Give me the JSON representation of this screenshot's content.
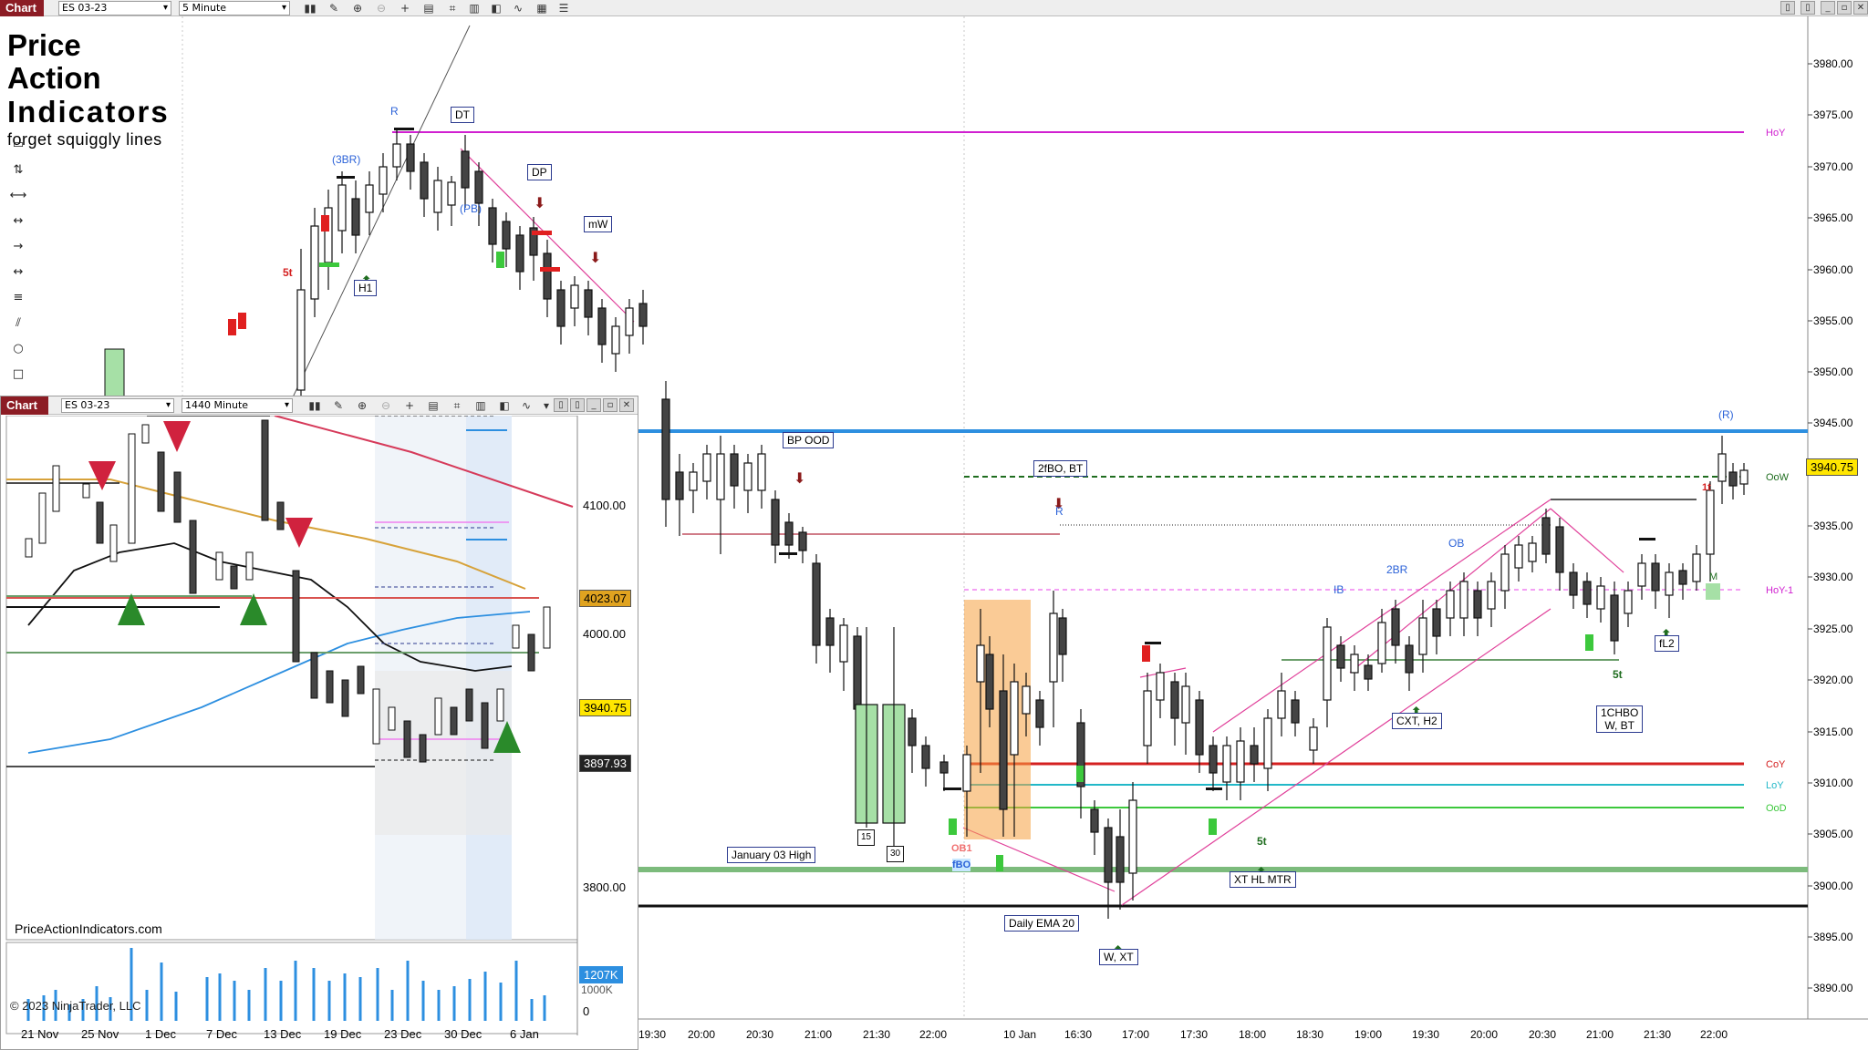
{
  "toolbar": {
    "tab_label": "Chart",
    "instrument": "ES 03-23",
    "interval": "5 Minute",
    "window_controls": [
      "minimize",
      "restore",
      "close"
    ]
  },
  "logo": {
    "line1": "Price Action",
    "line2": "Indicators",
    "line3": "forget squiggly lines"
  },
  "main_axis": {
    "price_ticks": [
      "3980.00",
      "3975.00",
      "3970.00",
      "3965.00",
      "3960.00",
      "3955.00",
      "3950.00",
      "3945.00",
      "3940.00",
      "3935.00",
      "3930.00",
      "3925.00",
      "3920.00",
      "3915.00",
      "3910.00",
      "3905.00",
      "3900.00",
      "3895.00",
      "3890.00"
    ],
    "time_ticks": [
      "19:30",
      "20:00",
      "20:30",
      "21:00",
      "21:30",
      "22:00",
      "10 Jan",
      "16:30",
      "17:00",
      "17:30",
      "18:00",
      "18:30",
      "19:00",
      "19:30",
      "20:00",
      "20:30",
      "21:00",
      "21:30",
      "22:00"
    ],
    "last_price": "3940.75"
  },
  "levels": {
    "hoy": "HoY",
    "oow": "OoW",
    "hoy1": "HoY-1",
    "coy": "CoY",
    "loy": "LoY",
    "ood": "OoD"
  },
  "annotations": {
    "r_top": "R",
    "dt": "DT",
    "three_br": "(3BR)",
    "dp": "DP",
    "pb": "(PB)",
    "mw": "mW",
    "h1": "H1",
    "five_t_left": "5t",
    "bp_ood": "BP OOD",
    "two_fbo": "2fBO, BT",
    "r_mid": "R",
    "ib": "IB",
    "two_br": "2BR",
    "ob": "OB",
    "r_paren": "(R)",
    "one_t": "1t",
    "m_box": "M",
    "fl2": "fL2",
    "five_t_a": "5t",
    "one_chbo_l1": "1CHBO",
    "one_chbo_l2": "W, BT",
    "cxt_h2": "CXT, H2",
    "five_t_b": "5t",
    "xt_hl_mtr": "XT HL MTR",
    "w_xt": "W, XT",
    "daily_ema": "Daily EMA 20",
    "jan03_high": "January 03 High",
    "fbo": "fBO",
    "ob1": "OB1",
    "n15": "15",
    "n30": "30"
  },
  "inset": {
    "tab_label": "Chart",
    "instrument": "ES 03-23",
    "interval": "1440 Minute",
    "watermark": "PriceActionIndicators.com",
    "copyright": "© 2023 NinjaTrader, LLC",
    "price_ticks": [
      "4100.00",
      "4000.00",
      "3800.00"
    ],
    "tag_gold": "4023.07",
    "tag_yellow": "3940.75",
    "tag_dark": "3897.93",
    "vol_tag": "1207K",
    "vol_tick_partial": "1000K",
    "vol_zero": "0",
    "date_ticks": [
      "21 Nov",
      "25 Nov",
      "1 Dec",
      "7 Dec",
      "13 Dec",
      "19 Dec",
      "23 Dec",
      "30 Dec",
      "6 Jan"
    ]
  },
  "colors": {
    "chart_tab": "#8c1c24",
    "hoy_magenta": "#d020d0",
    "oow_green": "#1f6d1f",
    "coy_red": "#d42020",
    "loy_cyan": "#22b8c8",
    "ood_green": "#3cc83c",
    "ema_blue": "#2d8fe0",
    "daily_ema_green": "#7cbb7c",
    "price_yellow": "#ffe600",
    "gold": "#e0a320"
  }
}
